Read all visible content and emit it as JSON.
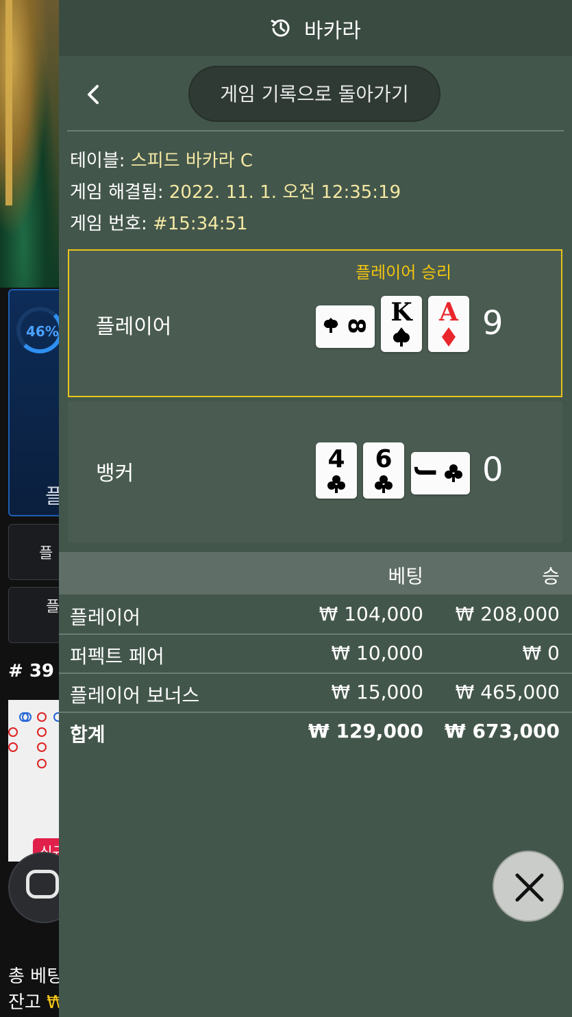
{
  "background": {
    "player_percent": "46%",
    "player_panel_partial": "플",
    "btn1_partial": "플",
    "btn2_partial": "플",
    "round_label": "# 39",
    "new_badge": "신규",
    "total_bet_label": "총 베팅금",
    "balance_label": "잔고",
    "balance_currency": "₩"
  },
  "header": {
    "icon": "history-icon",
    "title": "바카라"
  },
  "nav": {
    "back_icon": "chevron-left-icon",
    "back_to_history": "게임 기록으로 돌아가기"
  },
  "info": {
    "table_label": "테이블:",
    "table_value": "스피드 바카라 C",
    "resolved_label": "게임 해결됨:",
    "resolved_value": "2022. 11. 1. 오전 12:35:19",
    "game_no_label": "게임 번호:",
    "game_no_value": "#15:34:51"
  },
  "result": {
    "player": {
      "label": "플레이어",
      "win_label": "플레이어 승리",
      "score": "9",
      "cards": [
        {
          "rank": "8",
          "suit": "spade",
          "color": "#000000",
          "rotated": true
        },
        {
          "rank": "K",
          "suit": "spade",
          "color": "#000000",
          "rotated": false
        },
        {
          "rank": "A",
          "suit": "diamond",
          "color": "#e8262c",
          "rotated": false
        }
      ],
      "highlight_color": "#e8c51a"
    },
    "banker": {
      "label": "뱅커",
      "score": "0",
      "cards": [
        {
          "rank": "4",
          "suit": "club",
          "color": "#000000",
          "rotated": false
        },
        {
          "rank": "6",
          "suit": "club",
          "color": "#000000",
          "rotated": false
        },
        {
          "rank": "J",
          "suit": "club",
          "color": "#000000",
          "rotated": true
        }
      ]
    }
  },
  "bets": {
    "headers": {
      "bet": "베팅",
      "win": "승"
    },
    "rows": [
      {
        "name": "플레이어",
        "bet": "₩ 104,000",
        "win": "₩ 208,000"
      },
      {
        "name": "퍼펙트 페어",
        "bet": "₩ 10,000",
        "win": "₩ 0"
      },
      {
        "name": "플레이어 보너스",
        "bet": "₩ 15,000",
        "win": "₩ 465,000"
      }
    ],
    "total": {
      "name": "합계",
      "bet": "₩ 129,000",
      "win": "₩ 673,000"
    }
  },
  "close": {
    "icon": "close-icon"
  },
  "colors": {
    "panel_bg": "#43564b",
    "win_text": "#f3c50e",
    "info_value": "#f4e9a4"
  }
}
